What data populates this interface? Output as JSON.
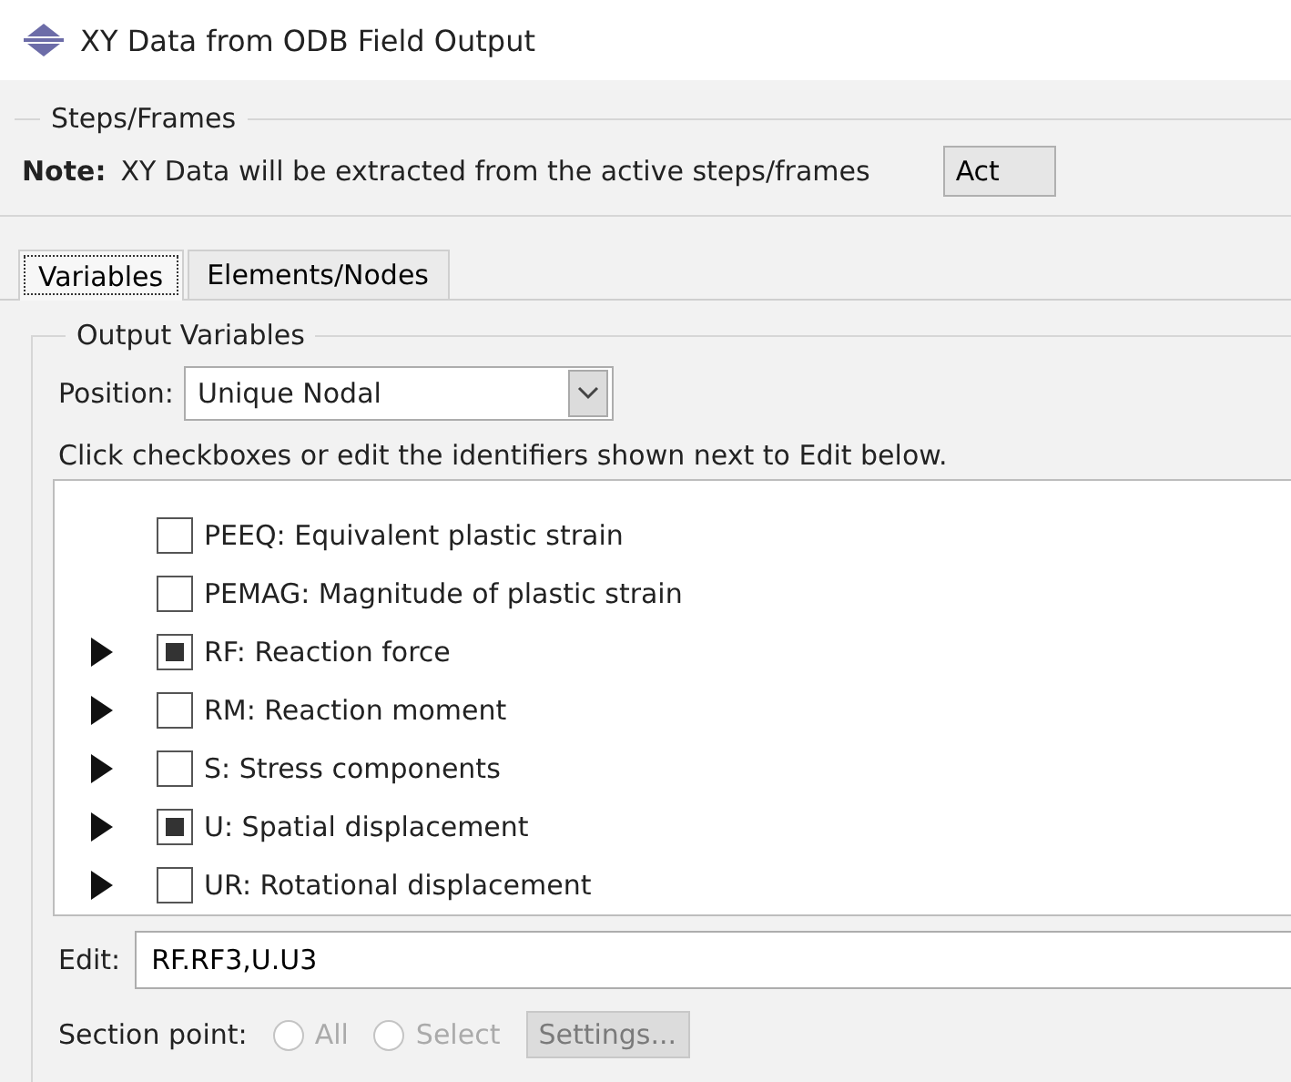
{
  "window": {
    "title": "XY Data from ODB Field Output"
  },
  "steps_frames": {
    "title": "Steps/Frames",
    "note_label": "Note:",
    "note_text": "XY Data will be extracted from the active steps/frames",
    "button": "Act"
  },
  "tabs": [
    {
      "label": "Variables",
      "selected": true
    },
    {
      "label": "Elements/Nodes",
      "selected": false
    }
  ],
  "output_variables": {
    "title": "Output Variables",
    "position_label": "Position:",
    "position_value": "Unique Nodal",
    "instruction": "Click checkboxes or edit the identifiers shown next to Edit below.",
    "items": [
      {
        "label": "PEEQ: Equivalent plastic strain",
        "expandable": false,
        "checked": false
      },
      {
        "label": "PEMAG: Magnitude of plastic strain",
        "expandable": false,
        "checked": false
      },
      {
        "label": "RF: Reaction force",
        "expandable": true,
        "checked": true
      },
      {
        "label": "RM: Reaction moment",
        "expandable": true,
        "checked": false
      },
      {
        "label": "S: Stress components",
        "expandable": true,
        "checked": false
      },
      {
        "label": "U: Spatial displacement",
        "expandable": true,
        "checked": true
      },
      {
        "label": "UR: Rotational displacement",
        "expandable": true,
        "checked": false
      }
    ],
    "edit_label": "Edit:",
    "edit_value": "RF.RF3,U.U3",
    "section_point": {
      "label": "Section point:",
      "options": [
        {
          "label": "All",
          "selected": false
        },
        {
          "label": "Select",
          "selected": false
        }
      ],
      "settings_button": "Settings...",
      "disabled": true
    }
  }
}
